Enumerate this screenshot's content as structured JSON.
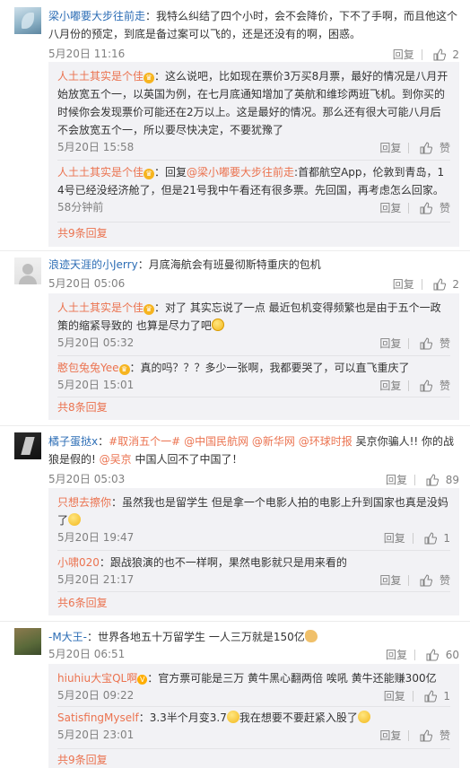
{
  "comments": [
    {
      "user": "梁小嘟要大步往前走",
      "text": "：我特么纠结了四个小时，会不会降价，下不了手啊，而且他这个八月份的预定，到底是备过案可以飞的，还是还没有的啊，困惑。",
      "time": "5月20日 11:16",
      "reply_label": "回复",
      "likes": "2",
      "replies": [
        {
          "user": "人土土其实是个佳",
          "text": "：这么说吧，比如现在票价3万买8月票，最好的情况是八月开始放宽五个一，以英国为例，在七月底通知增加了英航和维珍两班飞机。到你买的时候你会发现票价可能还在2万以上。这是最好的情况。那么还有很大可能八月后不会放宽五个一，所以要尽快决定，不要犹豫了",
          "time": "5月20日 15:58",
          "reply_label": "回复",
          "like_label": "赞"
        },
        {
          "user": "人土土其实是个佳",
          "text_prefix": "：回复",
          "mention": "@梁小嘟要大步往前走",
          "text": ":首都航空App，伦敦到青岛，14号已经没经济舱了，但是21号我中午看还有很多票。先回国，再考虑怎么回家。",
          "time": "58分钟前",
          "reply_label": "回复",
          "like_label": "赞"
        }
      ],
      "more": "共9条回复"
    },
    {
      "user": "浪迹天涯的小Jerry",
      "text": "：月底海航会有班曼彻斯特重庆的包机",
      "time": "5月20日 05:06",
      "reply_label": "回复",
      "likes": "2",
      "replies": [
        {
          "user": "人土土其实是个佳",
          "text": "：对了 其实忘说了一点 最近包机变得频繁也是由于五个一政策的缩紧导致的 也算是尽力了吧",
          "time": "5月20日 05:32",
          "reply_label": "回复",
          "like_label": "赞"
        },
        {
          "user": "憨包兔兔Yee",
          "text": "：真的吗？？？多少一张啊，我都要哭了，可以直飞重庆了",
          "time": "5月20日 15:01",
          "reply_label": "回复",
          "like_label": "赞"
        }
      ],
      "more": "共8条回复"
    },
    {
      "user": "橘子蛋挞x",
      "text_prefix": "：",
      "topic": "#取消五个一#",
      "m1": "@中国民航网",
      "m2": "@新华网",
      "m3": "@环球时报",
      "text_mid": " 吴京你骗人!! 你的战狼是假的! ",
      "m4": "@吴京",
      "text_end": " 中国人回不了中国了！",
      "time": "5月20日 05:03",
      "reply_label": "回复",
      "likes": "89",
      "replies": [
        {
          "user": "只想去擦你",
          "text": "：虽然我也是留学生 但是拿一个电影人拍的电影上升到国家也真是没妈了",
          "time": "5月20日 19:47",
          "reply_label": "回复",
          "likes": "1"
        },
        {
          "user": "小啸020",
          "text": "：跟战狼演的也不一样啊，果然电影就只是用来看的",
          "time": "5月20日 21:17",
          "reply_label": "回复",
          "like_label": "赞"
        }
      ],
      "more": "共6条回复"
    },
    {
      "user": "-M大王-",
      "text": "：世界各地五十万留学生 一人三万就是150亿",
      "time": "5月20日 06:51",
      "reply_label": "回复",
      "likes": "60",
      "replies": [
        {
          "user": "hiuhiu大宝QL啊",
          "text": "：官方票可能是三万 黄牛黑心翻两倍 唉吼 黄牛还能赚300亿",
          "time": "5月20日 09:22",
          "reply_label": "回复",
          "likes": "1"
        },
        {
          "user": "SatisfingMyself",
          "text": "：3.3半个月变3.7",
          "text2": "我在想要不要赶紧入股了",
          "time": "5月20日 23:01",
          "reply_label": "回复",
          "like_label": "赞"
        }
      ],
      "more": "共9条回复"
    }
  ],
  "colors": {
    "accent": "#eb7350",
    "reply_bg": "#f2f2f5",
    "meta": "#808080"
  }
}
